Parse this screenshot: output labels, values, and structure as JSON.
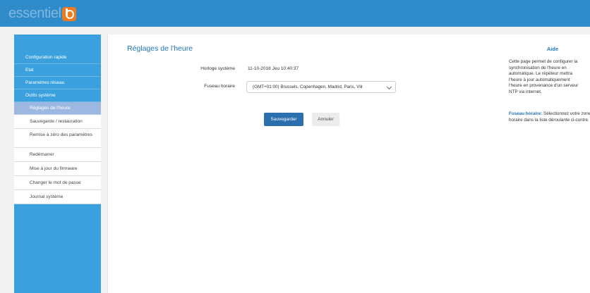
{
  "header": {
    "logo_text": "essentiel",
    "logo_badge": "b"
  },
  "sidebar": {
    "items": [
      {
        "label": "Configuration rapide"
      },
      {
        "label": "Etat"
      },
      {
        "label": "Paramètres réseau"
      },
      {
        "label": "Outils système"
      }
    ],
    "subitems": [
      {
        "label": "Réglages de l'heure"
      },
      {
        "label": "Sauvegarde / restauration"
      },
      {
        "label": "Remise à zéro des paramètres"
      },
      {
        "label": "Redémarrer"
      },
      {
        "label": "Mise à jour du firmware"
      },
      {
        "label": "Changer le mot de passe"
      },
      {
        "label": "Journal système"
      }
    ]
  },
  "main": {
    "title": "Réglages de l'heure",
    "clock_label": "Horloge système",
    "clock_value": "11-10-2018 Jeu 10:40:37",
    "timezone_label": "Fuseau horaire",
    "timezone_value": "(GMT+01:00) Brussels, Copenhagen, Madrid, Paris, Vilr",
    "save_label": "Sauvegarder",
    "cancel_label": "Annuler"
  },
  "help": {
    "title": "Aide",
    "para1": "Cette page permet de configurer la\nsynchronisation de l'heure en\nautomatique. Le répéteur mettra\nl'heure à jour automatiquement\nl'heure en provenance d'un serveur\nNTP via internet.",
    "para2_strong": "Fuseau horaire:",
    "para2_rest": " Sélectionnez votre zone horaire dans la liste déroulante ci-contre."
  },
  "colors": {
    "topbar": "#2f8bc9",
    "sidebar": "#3aa1de",
    "active_item": "#9db8e0",
    "accent": "#1e73b8",
    "save_button": "#2b6fae"
  }
}
